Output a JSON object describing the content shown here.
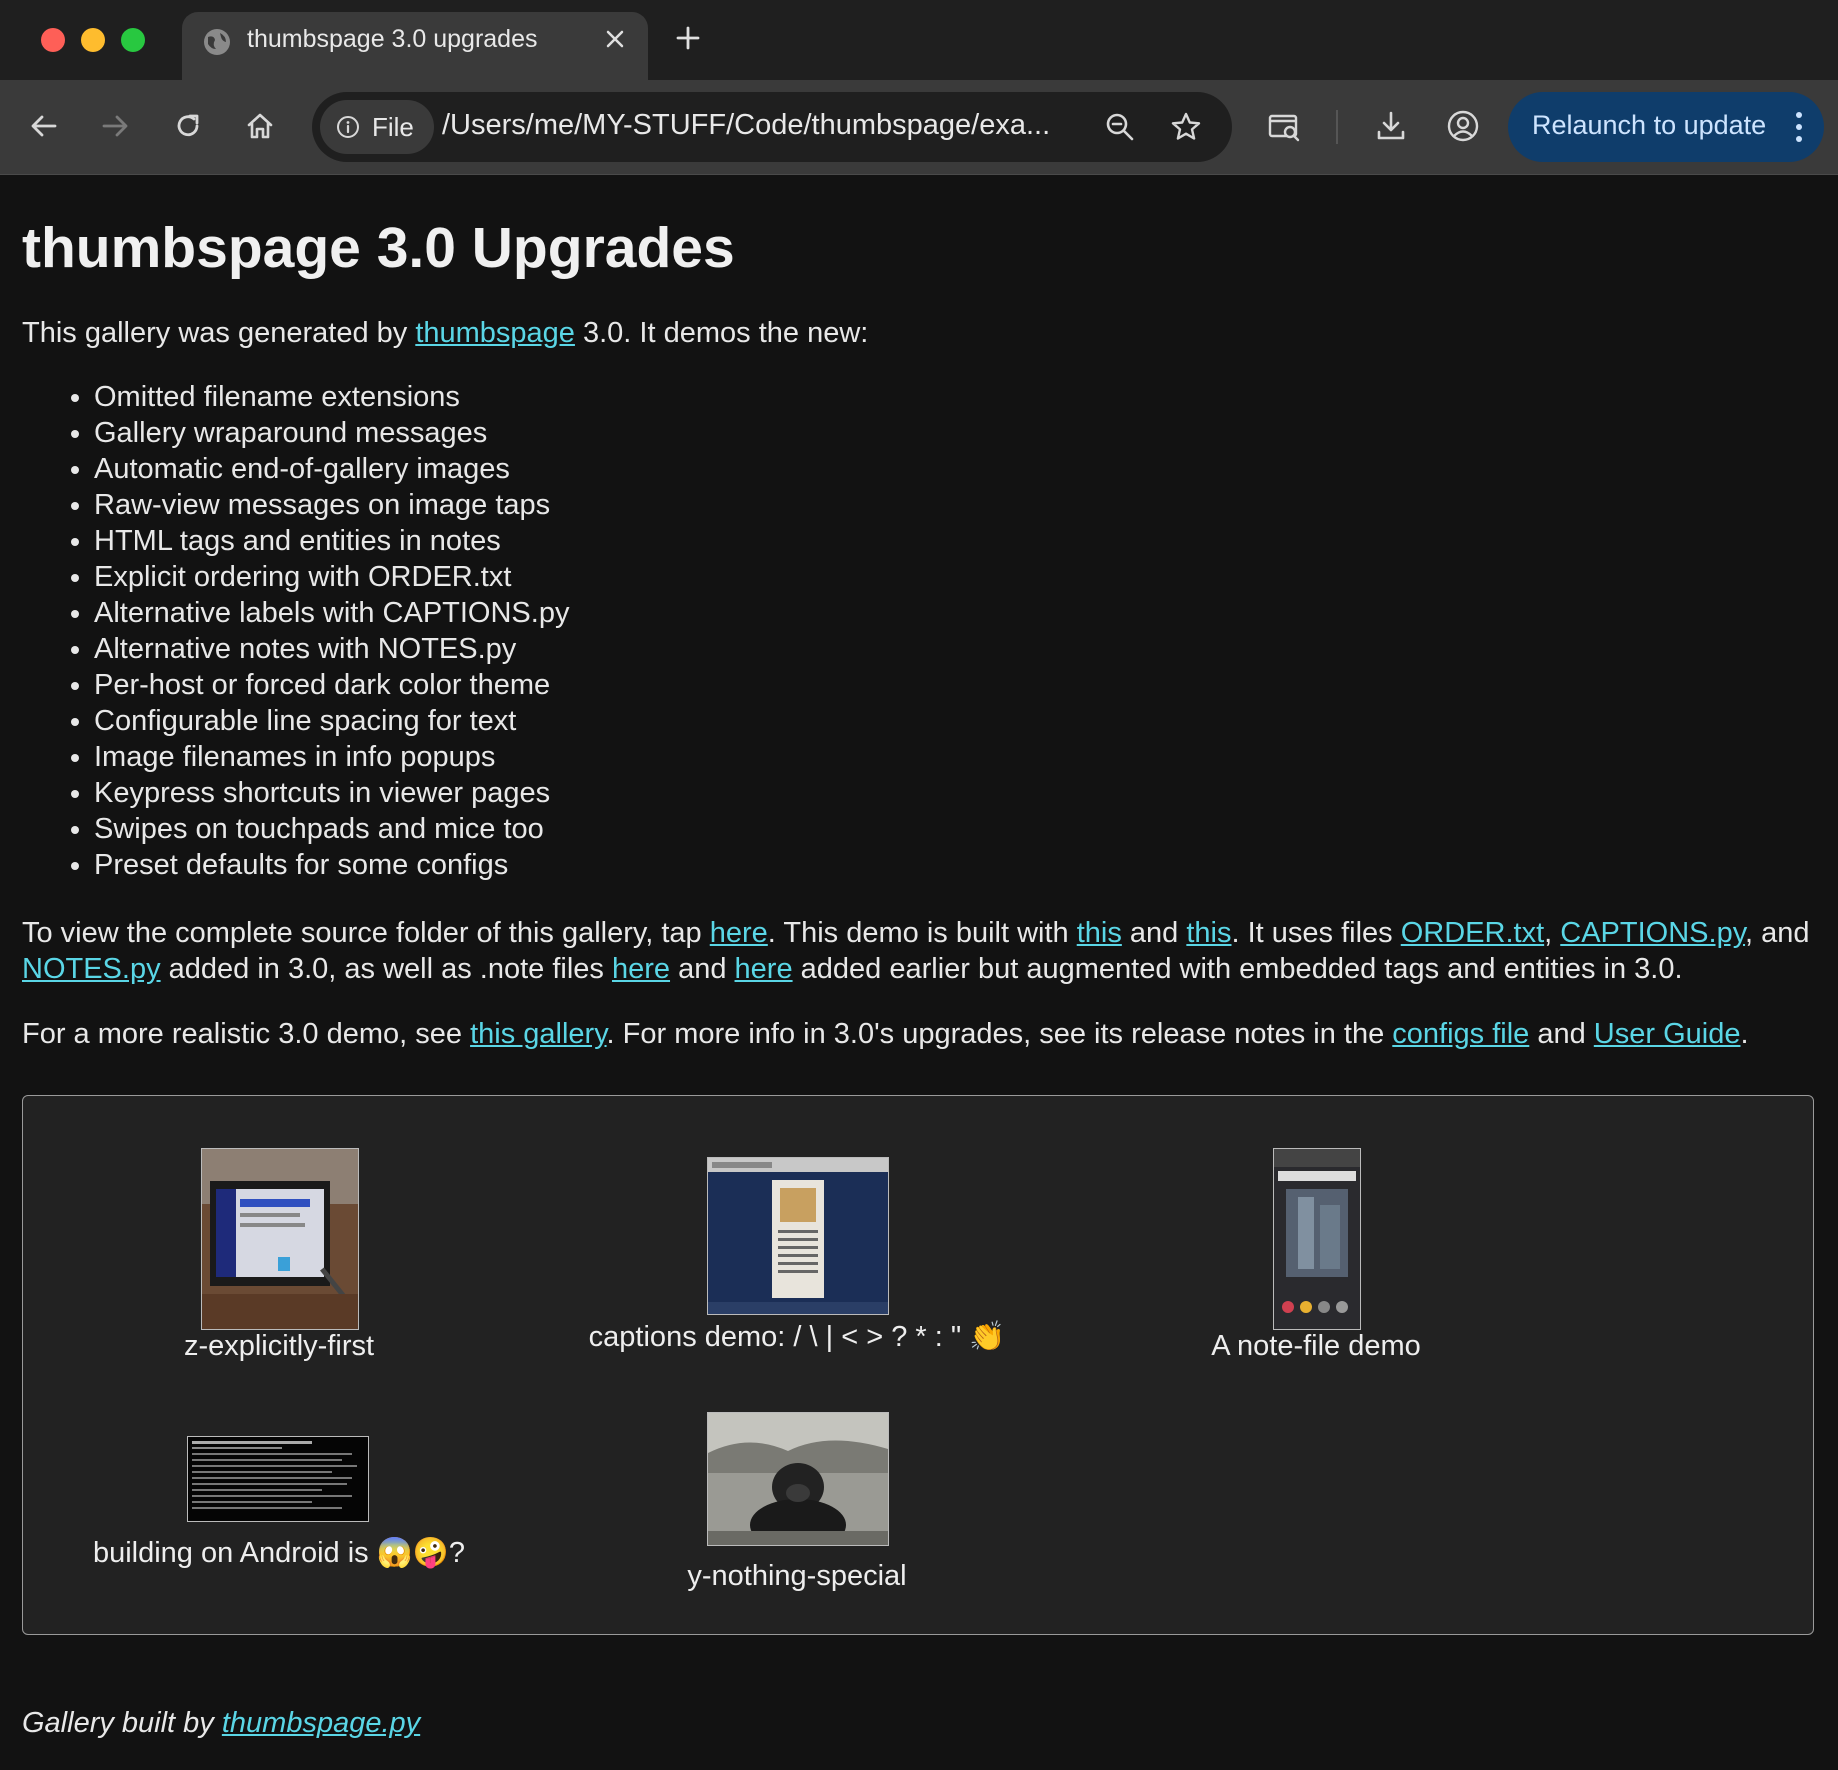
{
  "browser": {
    "tab_title": "thumbspage 3.0 upgrades",
    "chip_label": "File",
    "url": "/Users/me/MY-STUFF/Code/thumbspage/exa...",
    "relaunch_label": "Relaunch to update"
  },
  "page": {
    "title": "thumbspage 3.0 Upgrades",
    "intro": {
      "before": "This gallery was generated by ",
      "link": "thumbspage",
      "after": " 3.0. It demos the new:"
    },
    "features": [
      "Omitted filename extensions",
      "Gallery wraparound messages",
      "Automatic end-of-gallery images",
      "Raw-view messages on image taps",
      "HTML tags and entities in notes",
      "Explicit ordering with ORDER.txt",
      "Alternative labels with CAPTIONS.py",
      "Alternative notes with NOTES.py",
      "Per-host or forced dark color theme",
      "Configurable line spacing for text",
      "Image filenames in info popups",
      "Keypress shortcuts in viewer pages",
      "Swipes on touchpads and mice too",
      "Preset defaults for some configs"
    ],
    "para1": {
      "t1": "To view the complete source folder of this gallery, tap ",
      "l1": "here",
      "t2": ". This demo is built with ",
      "l2": "this",
      "t3": " and ",
      "l3": "this",
      "t4": ". It uses files ",
      "l4": "ORDER.txt",
      "t5": ", ",
      "l5": "CAPTIONS.py",
      "t6": ", and ",
      "l6": "NOTES.py",
      "t7": " added in 3.0, as well as .note files ",
      "l7": "here",
      "t8": " and ",
      "l8": "here",
      "t9": " added earlier but augmented with embedded tags and entities in 3.0."
    },
    "para2": {
      "t1": "For a more realistic 3.0 demo, see ",
      "l1": "this gallery",
      "t2": ". For more info in 3.0's upgrades, see its release notes in the ",
      "l2": "configs file",
      "t3": " and ",
      "l3": "User Guide",
      "t4": "."
    },
    "gallery": [
      {
        "caption": "z-explicitly-first"
      },
      {
        "caption": "captions demo: / \\ | < > ? * : \" 👏"
      },
      {
        "caption": "A note-file demo"
      },
      {
        "caption": "building on Android is 😱🤪?"
      },
      {
        "caption": "y-nothing-special"
      }
    ],
    "footer": {
      "text": "Gallery built by ",
      "link": "thumbspage.py"
    }
  },
  "colors": {
    "background": "#121212",
    "link": "#5ad6e6",
    "relaunch_bg": "#0f3d6b"
  }
}
